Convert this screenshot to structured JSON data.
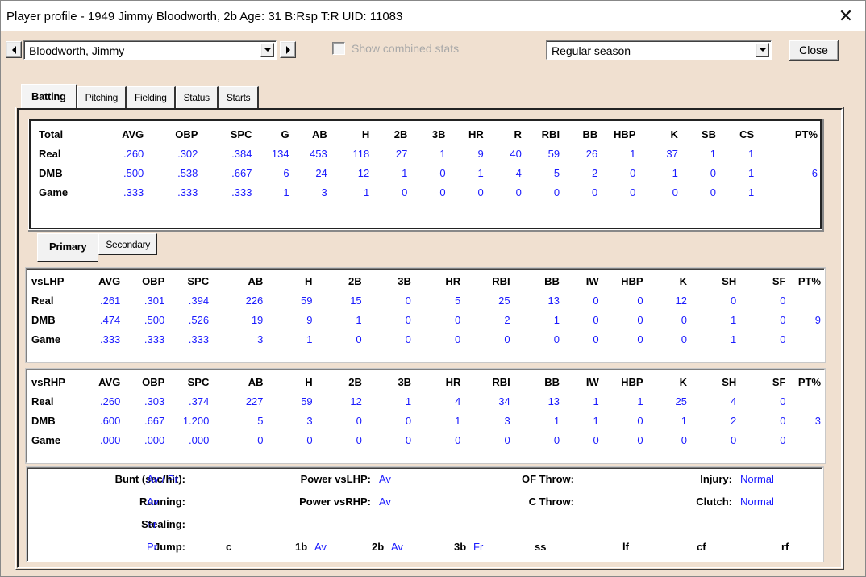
{
  "window": {
    "title": "Player profile - 1949 Jimmy Bloodworth, 2b  Age: 31  B:Rsp T:R  UID: 11083",
    "close_icon": "✕"
  },
  "toolbar": {
    "player_select": "Bloodworth, Jimmy",
    "show_combined_label": "Show combined stats",
    "show_combined_checked": false,
    "season_select": "Regular season",
    "close_label": "Close"
  },
  "tabs": [
    {
      "label": "Batting",
      "active": true
    },
    {
      "label": "Pitching",
      "active": false
    },
    {
      "label": "Fielding",
      "active": false
    },
    {
      "label": "Status",
      "active": false
    },
    {
      "label": "Starts",
      "active": false
    }
  ],
  "total": {
    "headers": [
      "Total",
      "AVG",
      "OBP",
      "SPC",
      "G",
      "AB",
      "H",
      "2B",
      "3B",
      "HR",
      "R",
      "RBI",
      "BB",
      "HBP",
      "K",
      "SB",
      "CS",
      "PT%"
    ],
    "rows": [
      [
        "Real",
        ".260",
        ".302",
        ".384",
        "134",
        "453",
        "118",
        "27",
        "1",
        "9",
        "40",
        "59",
        "26",
        "1",
        "37",
        "1",
        "1",
        ""
      ],
      [
        "DMB",
        ".500",
        ".538",
        ".667",
        "6",
        "24",
        "12",
        "1",
        "0",
        "1",
        "4",
        "5",
        "2",
        "0",
        "1",
        "0",
        "1",
        "6"
      ],
      [
        "Game",
        ".333",
        ".333",
        ".333",
        "1",
        "3",
        "1",
        "0",
        "0",
        "0",
        "0",
        "0",
        "0",
        "0",
        "0",
        "0",
        "1",
        ""
      ]
    ]
  },
  "subtabs": [
    {
      "label": "Primary",
      "active": true
    },
    {
      "label": "Secondary",
      "active": false
    }
  ],
  "vsLHP": {
    "headers": [
      "vsLHP",
      "AVG",
      "OBP",
      "SPC",
      "AB",
      "H",
      "2B",
      "3B",
      "HR",
      "RBI",
      "BB",
      "IW",
      "HBP",
      "K",
      "SH",
      "SF",
      "PT%"
    ],
    "rows": [
      [
        "Real",
        ".261",
        ".301",
        ".394",
        "226",
        "59",
        "15",
        "0",
        "5",
        "25",
        "13",
        "0",
        "0",
        "12",
        "0",
        "0",
        ""
      ],
      [
        "DMB",
        ".474",
        ".500",
        ".526",
        "19",
        "9",
        "1",
        "0",
        "0",
        "2",
        "1",
        "0",
        "0",
        "0",
        "1",
        "0",
        "9"
      ],
      [
        "Game",
        ".333",
        ".333",
        ".333",
        "3",
        "1",
        "0",
        "0",
        "0",
        "0",
        "0",
        "0",
        "0",
        "0",
        "1",
        "0",
        ""
      ]
    ]
  },
  "vsRHP": {
    "headers": [
      "vsRHP",
      "AVG",
      "OBP",
      "SPC",
      "AB",
      "H",
      "2B",
      "3B",
      "HR",
      "RBI",
      "BB",
      "IW",
      "HBP",
      "K",
      "SH",
      "SF",
      "PT%"
    ],
    "rows": [
      [
        "Real",
        ".260",
        ".303",
        ".374",
        "227",
        "59",
        "12",
        "1",
        "4",
        "34",
        "13",
        "1",
        "1",
        "25",
        "4",
        "0",
        ""
      ],
      [
        "DMB",
        ".600",
        ".667",
        "1.200",
        "5",
        "3",
        "0",
        "0",
        "1",
        "3",
        "1",
        "1",
        "0",
        "1",
        "2",
        "0",
        "3"
      ],
      [
        "Game",
        ".000",
        ".000",
        ".000",
        "0",
        "0",
        "0",
        "0",
        "0",
        "0",
        "0",
        "0",
        "0",
        "0",
        "0",
        "0",
        ""
      ]
    ]
  },
  "ratings": {
    "bunt_label": "Bunt (sac/hit):",
    "bunt_value": "Av / Pr",
    "running_label": "Running:",
    "running_value": "Av",
    "stealing_label": "Stealing:",
    "stealing_value": "Fr",
    "jump_label": "Jump:",
    "jump_value": "Pr",
    "power_lhp_label": "Power vsLHP:",
    "power_lhp_value": "Av",
    "power_rhp_label": "Power vsRHP:",
    "power_rhp_value": "Av",
    "of_throw_label": "OF Throw:",
    "of_throw_value": "",
    "c_throw_label": "C Throw:",
    "c_throw_value": "",
    "injury_label": "Injury:",
    "injury_value": "Normal",
    "clutch_label": "Clutch:",
    "clutch_value": "Normal",
    "positions": [
      {
        "pos": "c",
        "rating": ""
      },
      {
        "pos": "1b",
        "rating": "Av"
      },
      {
        "pos": "2b",
        "rating": "Av"
      },
      {
        "pos": "3b",
        "rating": "Fr"
      },
      {
        "pos": "ss",
        "rating": ""
      },
      {
        "pos": "lf",
        "rating": ""
      },
      {
        "pos": "cf",
        "rating": ""
      },
      {
        "pos": "rf",
        "rating": ""
      }
    ]
  }
}
